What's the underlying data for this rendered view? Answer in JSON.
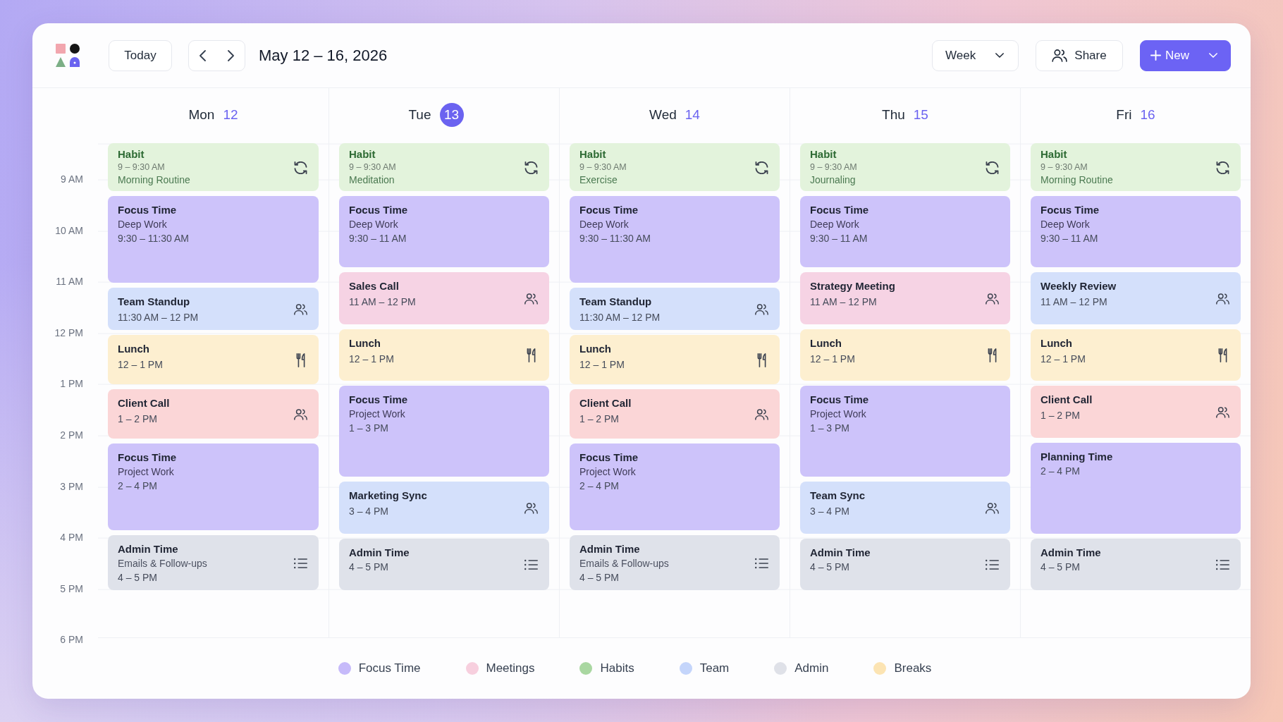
{
  "header": {
    "today_button": "Today",
    "date_range": "May 12 – 16, 2026",
    "view_select": "Week",
    "share_button": "Share",
    "new_button": "New"
  },
  "days": [
    {
      "name": "Mon",
      "date": "12",
      "today": false,
      "events": [
        {
          "kind": "habit",
          "color": "#e3f3dc",
          "title": "Habit",
          "time": "9 – 9:30 AM",
          "note": "Morning Routine"
        },
        {
          "kind": "focus",
          "color": "#cdc3fa",
          "title": "Focus Time",
          "note": "Deep Work",
          "time": "9:30 – 11:30 AM"
        },
        {
          "kind": "team",
          "color": "#d4e0fb",
          "title": "Team Standup",
          "time": "11:30 AM – 12 PM"
        },
        {
          "kind": "break",
          "color": "#fdefd0",
          "title": "Lunch",
          "time": "12 – 1 PM"
        },
        {
          "kind": "meeting",
          "color": "#fbd6d7",
          "title": "Client Call",
          "time": "1 – 2 PM"
        },
        {
          "kind": "focus",
          "color": "#cdc3fa",
          "title": "Focus Time",
          "note": "Project Work",
          "time": "2 – 4 PM"
        },
        {
          "kind": "admin",
          "color": "#dfe2ea",
          "title": "Admin Time",
          "note": "Emails & Follow-ups",
          "time": "4 – 5 PM"
        }
      ]
    },
    {
      "name": "Tue",
      "date": "13",
      "today": true,
      "events": [
        {
          "kind": "habit",
          "color": "#e3f3dc",
          "title": "Habit",
          "time": "9 – 9:30 AM",
          "note": "Meditation"
        },
        {
          "kind": "focus",
          "color": "#cdc3fa",
          "title": "Focus Time",
          "note": "Deep Work",
          "time": "9:30 – 11 AM"
        },
        {
          "kind": "meeting",
          "color": "#f6d3e4",
          "title": "Sales Call",
          "time": "11 AM – 12 PM"
        },
        {
          "kind": "break",
          "color": "#fdefd0",
          "title": "Lunch",
          "time": "12 – 1 PM"
        },
        {
          "kind": "focus",
          "color": "#cdc3fa",
          "title": "Focus Time",
          "note": "Project Work",
          "time": "1 – 3 PM"
        },
        {
          "kind": "team",
          "color": "#d4e0fb",
          "title": "Marketing Sync",
          "time": "3 – 4 PM"
        },
        {
          "kind": "admin",
          "color": "#dfe2ea",
          "title": "Admin Time",
          "time": "4 – 5 PM"
        }
      ]
    },
    {
      "name": "Wed",
      "date": "14",
      "today": false,
      "events": [
        {
          "kind": "habit",
          "color": "#e3f3dc",
          "title": "Habit",
          "time": "9 – 9:30 AM",
          "note": "Exercise"
        },
        {
          "kind": "focus",
          "color": "#cdc3fa",
          "title": "Focus Time",
          "note": "Deep Work",
          "time": "9:30 – 11:30 AM"
        },
        {
          "kind": "team",
          "color": "#d4e0fb",
          "title": "Team Standup",
          "time": "11:30 AM – 12 PM"
        },
        {
          "kind": "break",
          "color": "#fdefd0",
          "title": "Lunch",
          "time": "12 – 1 PM"
        },
        {
          "kind": "meeting",
          "color": "#fbd6d7",
          "title": "Client Call",
          "time": "1 – 2 PM"
        },
        {
          "kind": "focus",
          "color": "#cdc3fa",
          "title": "Focus Time",
          "note": "Project Work",
          "time": "2 – 4 PM"
        },
        {
          "kind": "admin",
          "color": "#dfe2ea",
          "title": "Admin Time",
          "note": "Emails & Follow-ups",
          "time": "4 – 5 PM"
        }
      ]
    },
    {
      "name": "Thu",
      "date": "15",
      "today": false,
      "events": [
        {
          "kind": "habit",
          "color": "#e3f3dc",
          "title": "Habit",
          "time": "9 – 9:30 AM",
          "note": "Journaling"
        },
        {
          "kind": "focus",
          "color": "#cdc3fa",
          "title": "Focus Time",
          "note": "Deep Work",
          "time": "9:30 – 11 AM"
        },
        {
          "kind": "meeting",
          "color": "#f6d3e4",
          "title": "Strategy Meeting",
          "time": "11 AM – 12 PM"
        },
        {
          "kind": "break",
          "color": "#fdefd0",
          "title": "Lunch",
          "time": "12 – 1 PM"
        },
        {
          "kind": "focus",
          "color": "#cdc3fa",
          "title": "Focus Time",
          "note": "Project Work",
          "time": "1 – 3 PM"
        },
        {
          "kind": "team",
          "color": "#d4e0fb",
          "title": "Team Sync",
          "time": "3 – 4 PM"
        },
        {
          "kind": "admin",
          "color": "#dfe2ea",
          "title": "Admin Time",
          "time": "4 – 5 PM"
        }
      ]
    },
    {
      "name": "Fri",
      "date": "16",
      "today": false,
      "events": [
        {
          "kind": "habit",
          "color": "#e3f3dc",
          "title": "Habit",
          "time": "9 – 9:30 AM",
          "note": "Morning Routine"
        },
        {
          "kind": "focus",
          "color": "#cdc3fa",
          "title": "Focus Time",
          "note": "Deep Work",
          "time": "9:30 – 11 AM"
        },
        {
          "kind": "team",
          "color": "#d4e0fb",
          "title": "Weekly Review",
          "time": "11 AM – 12 PM"
        },
        {
          "kind": "break",
          "color": "#fdefd0",
          "title": "Lunch",
          "time": "12 – 1 PM"
        },
        {
          "kind": "meeting",
          "color": "#fbd6d7",
          "title": "Client Call",
          "time": "1 – 2 PM"
        },
        {
          "kind": "focus",
          "color": "#cdc3fa",
          "title": "Planning Time",
          "time": "2 – 4 PM"
        },
        {
          "kind": "admin",
          "color": "#dfe2ea",
          "title": "Admin Time",
          "time": "4 – 5 PM"
        }
      ]
    }
  ],
  "time_labels": [
    "9 AM",
    "10 AM",
    "11 AM",
    "12 PM",
    "1 PM",
    "2 PM",
    "3 PM",
    "4 PM",
    "5 PM",
    "6 PM"
  ],
  "legend": [
    {
      "label": "Focus Time",
      "color": "#c6bafa"
    },
    {
      "label": "Meetings",
      "color": "#f7cfde"
    },
    {
      "label": "Habits",
      "color": "#a9d7a1"
    },
    {
      "label": "Team",
      "color": "#c4d5fb"
    },
    {
      "label": "Admin",
      "color": "#dfe1e8"
    },
    {
      "label": "Breaks",
      "color": "#fce4b3"
    }
  ]
}
